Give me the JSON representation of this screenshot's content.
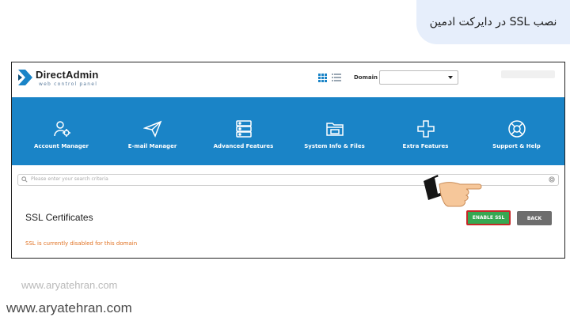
{
  "caption": {
    "title": "نصب SSL در دایرکت ادمین"
  },
  "header": {
    "logo_name": "DirectAdmin",
    "logo_tagline": "web control panel",
    "domain_label": "Domain",
    "domain_value": ""
  },
  "nav": {
    "items": [
      {
        "label": "Account Manager",
        "icon": "account-manager-icon"
      },
      {
        "label": "E-mail Manager",
        "icon": "paper-plane-icon"
      },
      {
        "label": "Advanced Features",
        "icon": "server-stack-icon"
      },
      {
        "label": "System Info & Files",
        "icon": "folder-icon"
      },
      {
        "label": "Extra Features",
        "icon": "plus-icon"
      },
      {
        "label": "Support & Help",
        "icon": "lifebuoy-icon"
      }
    ]
  },
  "search": {
    "placeholder": "Please enter your search criteria"
  },
  "main": {
    "title": "SSL Certificates",
    "message": "SSL is currently disabled for this domain",
    "enable_button": "ENABLE SSL",
    "back_button": "BACK"
  },
  "watermark": {
    "faded": "www.aryatehran.com",
    "main": "www.aryatehran.com"
  },
  "colors": {
    "nav_bg": "#1a84c7",
    "enable_btn": "#36a852",
    "highlight_border": "#c62828",
    "back_btn": "#6d6d6d",
    "warning_text": "#e07020",
    "caption_bg": "#e6eefb"
  }
}
